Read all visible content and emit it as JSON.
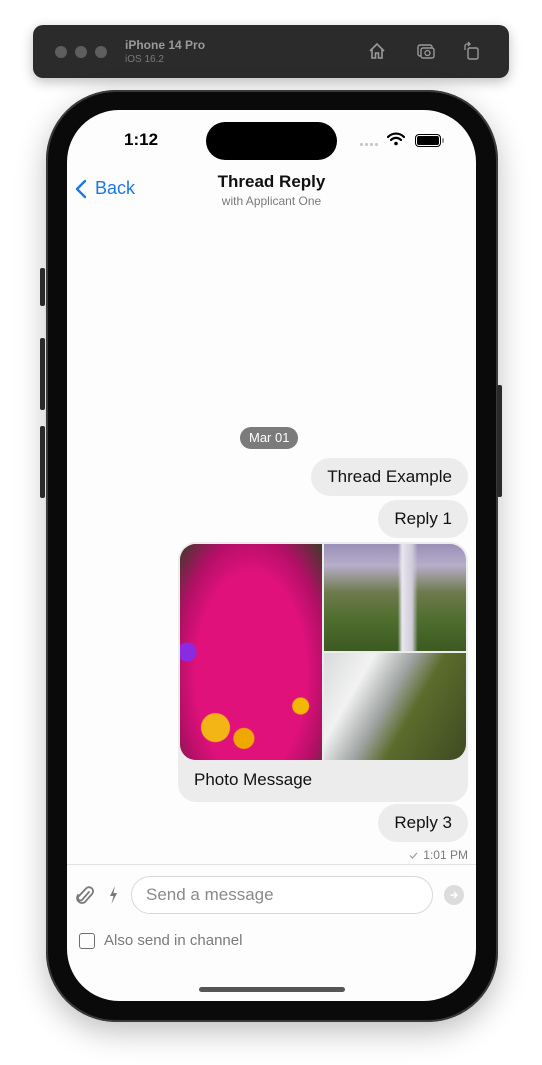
{
  "simulator": {
    "device_name": "iPhone 14 Pro",
    "os_version": "iOS 16.2",
    "toolbar_icons": [
      "home-icon",
      "screenshot-icon",
      "rotate-icon"
    ]
  },
  "status_bar": {
    "time": "1:12",
    "icons": [
      "cellular-signal-icon",
      "wifi-icon",
      "battery-icon"
    ]
  },
  "nav": {
    "back_label": "Back",
    "title": "Thread Reply",
    "subtitle": "with Applicant One"
  },
  "thread": {
    "date_separator": "Mar 01",
    "messages": [
      {
        "type": "text",
        "text": "Thread Example"
      },
      {
        "type": "text",
        "text": "Reply 1"
      },
      {
        "type": "photos",
        "caption": "Photo Message",
        "images": [
          "pink-flowers-photo",
          "waterfall-cliff-photo",
          "waterfall-rocks-photo"
        ]
      },
      {
        "type": "text",
        "text": "Reply 3"
      }
    ],
    "last_message_time": "1:01 PM",
    "last_message_status": "delivered"
  },
  "composer": {
    "placeholder": "Send a message",
    "value": "",
    "also_send_label": "Also send in channel",
    "also_send_checked": false
  }
}
